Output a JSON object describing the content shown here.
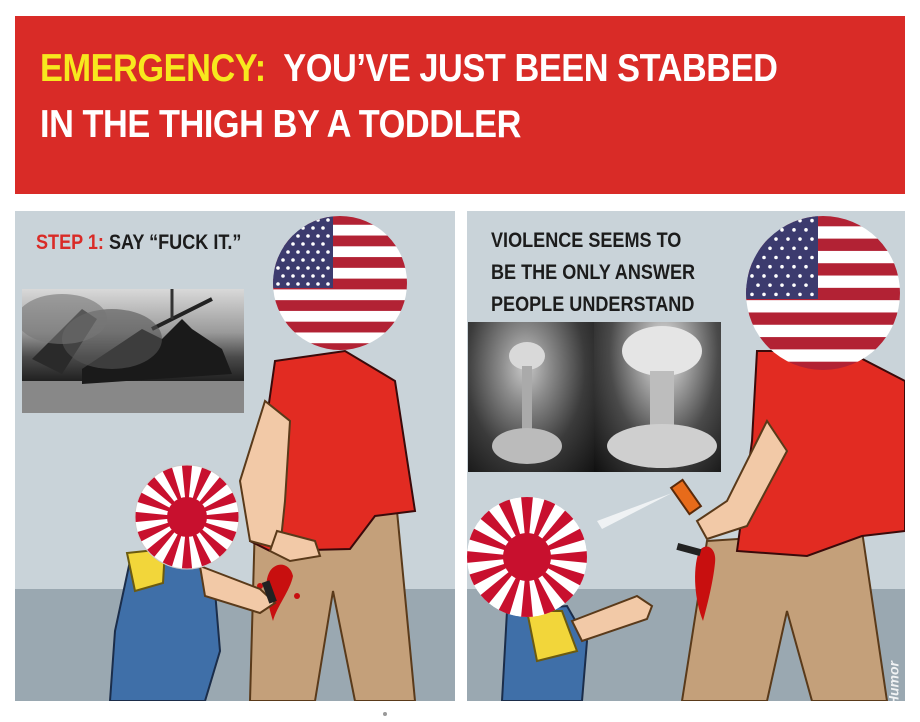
{
  "banner": {
    "highlight": "EMERGENCY:",
    "line1_rest": "YOU’VE JUST BEEN STABBED",
    "line2": "IN THE THIGH BY A TODDLER"
  },
  "panel1": {
    "step_label": "STEP 1:",
    "step_text": "SAY “FUCK IT.”"
  },
  "panel2": {
    "caption_lines": [
      "VIOLENCE SEEMS TO",
      "BE THE ONLY ANSWER",
      "PEOPLE UNDERSTAND"
    ],
    "watermark": "CollegeHumor"
  },
  "colors": {
    "banner_red": "#d92b27",
    "highlight_yellow": "#f7e81e",
    "wall": "#c9d3d9",
    "floor": "#9aa8b1",
    "shirt_red": "#e22b22",
    "pants_tan": "#c4a07a",
    "overalls_blue": "#3f6fa8",
    "flag_blue": "#3c3b6e",
    "flag_red": "#b22234",
    "rising_sun_red": "#c8102e"
  },
  "icons": [
    "us-flag-icon",
    "rising-sun-flag-icon",
    "knife-icon",
    "spray-can-icon"
  ]
}
